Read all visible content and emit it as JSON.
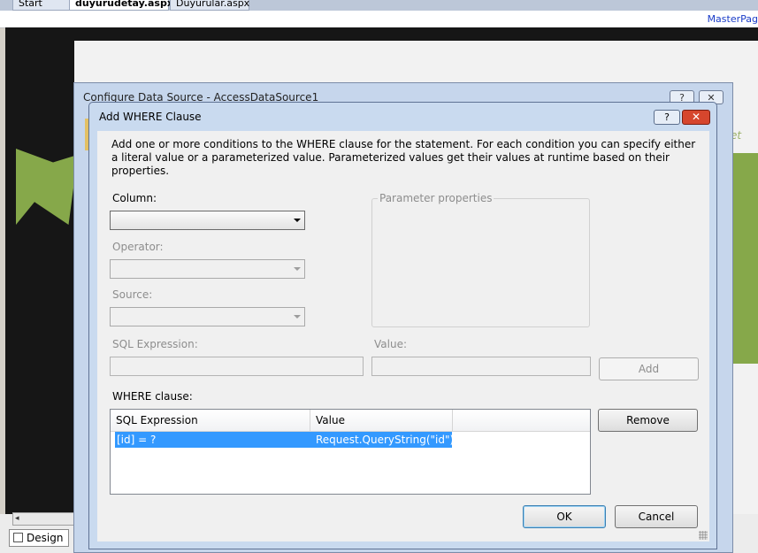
{
  "ide": {
    "tabs": [
      {
        "label": "Start Page"
      },
      {
        "label": "duyurudetay.aspx"
      },
      {
        "label": "Duyurular.aspx"
      }
    ],
    "masterpage_label": "MasterPag",
    "side_text": "et",
    "design_tab": "Design",
    "scroll_left": "◂"
  },
  "back_dialog": {
    "title": "Configure Data Source - AccessDataSource1",
    "help": "?",
    "close": "✕"
  },
  "dialog": {
    "title": "Add WHERE Clause",
    "help": "?",
    "close": "✕",
    "description": "Add one or more conditions to the WHERE clause for the statement. For each condition you can specify either a literal value or a parameterized value. Parameterized values get their values at runtime based on their properties.",
    "column_label": "Column:",
    "column_value": "",
    "operator_label": "Operator:",
    "source_label": "Source:",
    "parameter_properties_label": "Parameter properties",
    "sql_expression_label": "SQL Expression:",
    "value_label": "Value:",
    "sql_expression_value": "",
    "value_value": "",
    "add_button": "Add",
    "where_clause_label": "WHERE clause:",
    "table": {
      "columns": [
        "SQL Expression",
        "Value"
      ],
      "rows": [
        {
          "expression": "[id] = ?",
          "value": "Request.QueryString(\"id\")"
        }
      ]
    },
    "remove_button": "Remove",
    "ok_button": "OK",
    "cancel_button": "Cancel"
  }
}
